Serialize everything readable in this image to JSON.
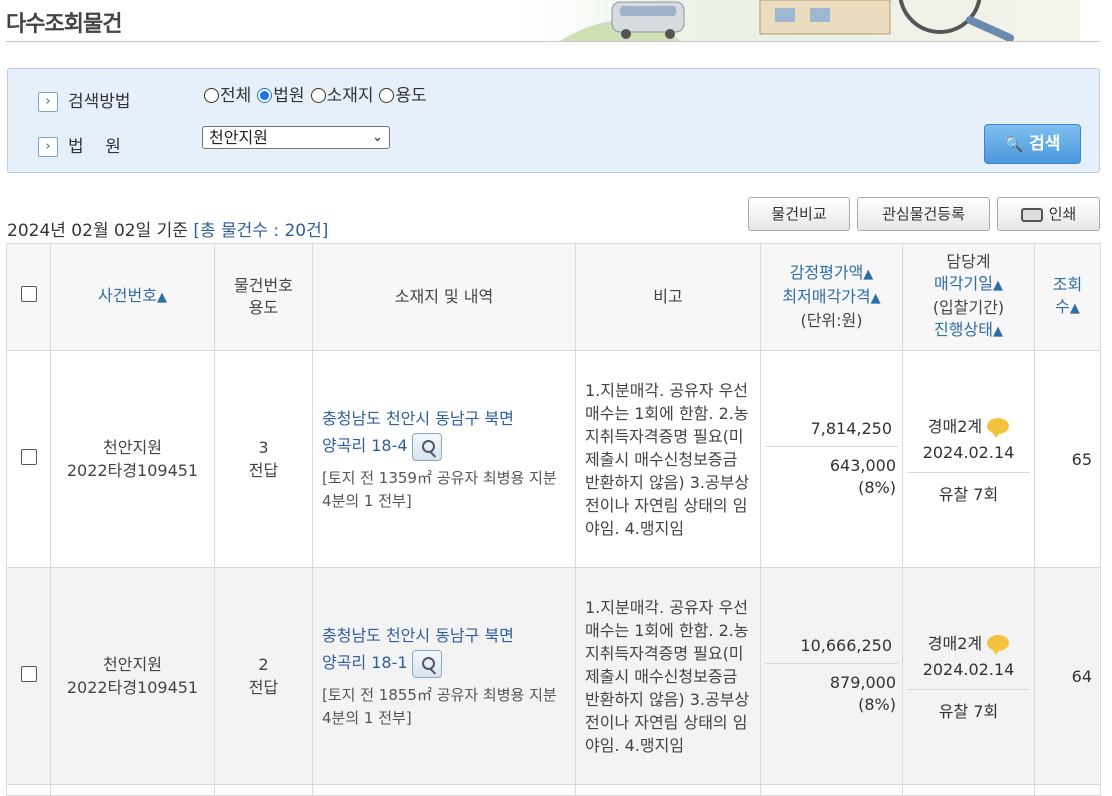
{
  "page": {
    "title": "다수조회물건"
  },
  "search": {
    "method_label": "검색방법",
    "court_label": "법    원",
    "radios": [
      {
        "label": "전체",
        "checked": false
      },
      {
        "label": "법원",
        "checked": true
      },
      {
        "label": "소재지",
        "checked": false
      },
      {
        "label": "용도",
        "checked": false
      }
    ],
    "court_selected": "천안지원",
    "button_label": "검색"
  },
  "info": {
    "date_text": "2024년 02월 02일 기준",
    "total_text": "[총 물건수 : 20건]"
  },
  "toolbar": {
    "compare_label": "물건비교",
    "interest_label": "관심물건등록",
    "print_label": "인쇄"
  },
  "table": {
    "headers": {
      "case_no": "사건번호",
      "item_no_1": "물건번호",
      "item_no_2": "용도",
      "location": "소재지 및 내역",
      "note": "비고",
      "price_1": "감정평가액",
      "price_2": "최저매각가격",
      "price_3": "(단위:원)",
      "mgr_1": "담당계",
      "mgr_2": "매각기일",
      "mgr_3": "(입찰기간)",
      "mgr_4": "진행상태",
      "views_1": "조회",
      "views_2": "수",
      "sort_mark": "▲"
    },
    "rows": [
      {
        "court": "천안지원",
        "case_no": "2022타경109451",
        "item_no": "3",
        "usage": "전답",
        "addr_line1": "충청남도 천안시 동남구 북면",
        "addr_line2": "양곡리 18-4",
        "desc": "[토지 전 1359㎡ 공유자 최병용 지분 4분의 1 전부]",
        "note": "1.지분매각. 공유자 우선매수는 1회에 한함. 2.농지취득자격증명 필요(미제출시 매수신청보증금 반환하지 않음) 3.공부상 전이나 자연림 상태의 임야임. 4.맹지임",
        "appraisal": "7,814,250",
        "min_price": "643,000",
        "min_pct": "(8%)",
        "dept": "경매2계",
        "sale_date": "2024.02.14",
        "status": "유찰 7회",
        "views": "65"
      },
      {
        "court": "천안지원",
        "case_no": "2022타경109451",
        "item_no": "2",
        "usage": "전답",
        "addr_line1": "충청남도 천안시 동남구 북면",
        "addr_line2": "양곡리 18-1",
        "desc": "[토지 전 1855㎡ 공유자 최병용 지분 4분의 1 전부]",
        "note": "1.지분매각. 공유자 우선매수는 1회에 한함. 2.농지취득자격증명 필요(미제출시 매수신청보증금 반환하지 않음) 3.공부상 전이나 자연림 상태의 임야임. 4.맹지임",
        "appraisal": "10,666,250",
        "min_price": "879,000",
        "min_pct": "(8%)",
        "dept": "경매2계",
        "sale_date": "2024.02.14",
        "status": "유찰 7회",
        "views": "64"
      }
    ]
  }
}
